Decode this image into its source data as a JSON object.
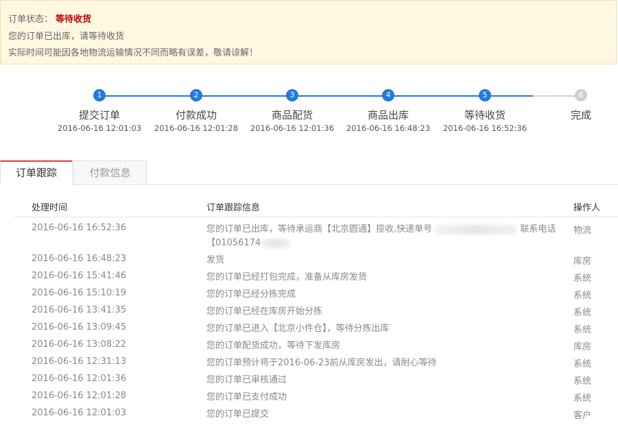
{
  "status": {
    "label": "订单状态：",
    "value": "等待收货",
    "line2": "您的订单已出库，请等待收货",
    "line3": "实际时间可能因各地物流运输情况不同而略有误差，敬请谅解！",
    "accent_color": "#c00000"
  },
  "progress": {
    "active_color": "#1f7be0",
    "inactive_color": "#cfcfcf",
    "steps": [
      {
        "num": "1",
        "label": "提交订单",
        "time": "2016-06-16 12:01:03"
      },
      {
        "num": "2",
        "label": "付款成功",
        "time": "2016-06-16 12:01:28"
      },
      {
        "num": "3",
        "label": "商品配货",
        "time": "2016-06-16 12:01:36"
      },
      {
        "num": "4",
        "label": "商品出库",
        "time": "2016-06-16 16:48:23"
      },
      {
        "num": "5",
        "label": "等待收货",
        "time": "2016-06-16 16:52:36"
      },
      {
        "num": "6",
        "label": "完成",
        "time": ""
      }
    ]
  },
  "tabs": [
    {
      "label": "订单跟踪"
    },
    {
      "label": "付款信息"
    }
  ],
  "table": {
    "headers": [
      "处理时间",
      "订单跟踪信息",
      "操作人"
    ],
    "rows": [
      {
        "time": "2016-06-16 16:52:36",
        "info_a": "您的订单已出库，等待承运商【北京圆通】揽收,快递单号 ",
        "info_b": " 联系电话【01056174",
        "info_c": "",
        "operator": "物流"
      },
      {
        "time": "2016-06-16 16:48:23",
        "info": "发货",
        "operator": "库房"
      },
      {
        "time": "2016-06-16 15:41:46",
        "info": "您的订单已经打包完成，准备从库房发货",
        "operator": "系统"
      },
      {
        "time": "2016-06-16 15:10:19",
        "info": "您的订单已经分拣完成",
        "operator": "系统"
      },
      {
        "time": "2016-06-16 13:41:35",
        "info": "您的订单已经在库房开始分拣",
        "operator": "系统"
      },
      {
        "time": "2016-06-16 13:09:45",
        "info": "您的订单已进入【北京小件仓】，等待分拣出库",
        "operator": "系统"
      },
      {
        "time": "2016-06-16 13:08:22",
        "info": "您的订单配货成功，等待下发库房",
        "operator": "库房"
      },
      {
        "time": "2016-06-16 12:31:13",
        "info": "您的订单预计将于2016-06-23前从库房发出，请耐心等待",
        "operator": "系统"
      },
      {
        "time": "2016-06-16 12:01:36",
        "info": "您的订单已审核通过",
        "operator": "系统"
      },
      {
        "time": "2016-06-16 12:01:28",
        "info": "您的订单已支付成功",
        "operator": "系统"
      },
      {
        "time": "2016-06-16 12:01:03",
        "info": "您的订单已提交",
        "operator": "客户"
      }
    ]
  }
}
